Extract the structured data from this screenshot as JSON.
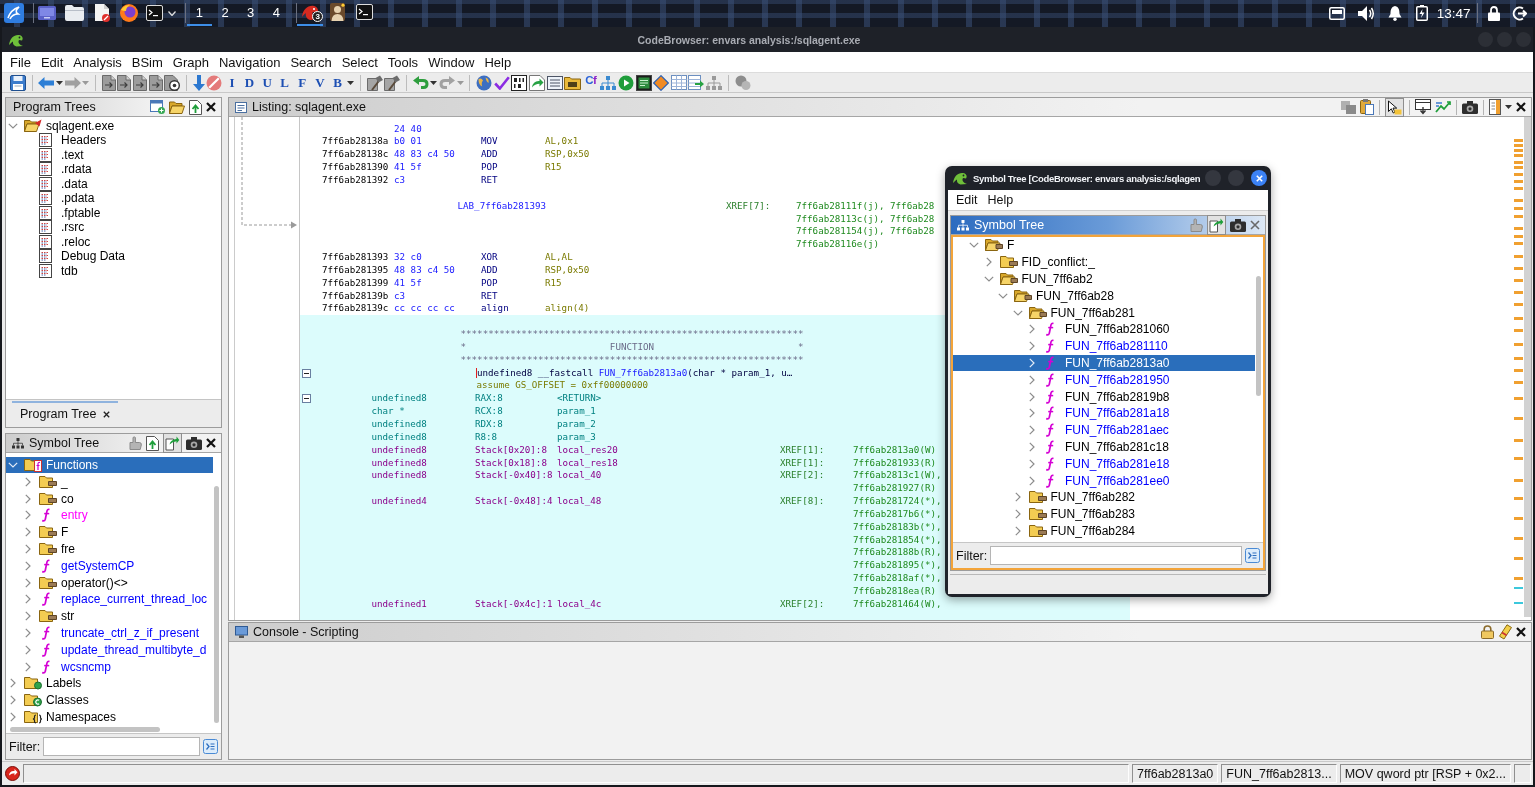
{
  "taskbar": {
    "workspaces": [
      {
        "label": "1",
        "selected": true
      },
      {
        "label": "2",
        "selected": false
      },
      {
        "label": "3",
        "selected": false
      },
      {
        "label": "4",
        "selected": false
      }
    ],
    "apps": [
      {
        "selected": true,
        "badge": "3"
      },
      {
        "selected": false
      },
      {
        "selected": false
      }
    ],
    "clock": "13:47"
  },
  "window": {
    "title": "CodeBrowser: envars analysis:/sqlagent.exe"
  },
  "menu": [
    "File",
    "Edit",
    "Analysis",
    "BSim",
    "Graph",
    "Navigation",
    "Search",
    "Select",
    "Tools",
    "Window",
    "Help"
  ],
  "toolbar": {
    "letter_buttons": [
      "I",
      "D",
      "U",
      "L",
      "F",
      "V",
      "B"
    ],
    "glyph_button": "Cf"
  },
  "program_trees": {
    "title": "Program Trees",
    "tree": [
      {
        "label": "sqlagent.exe",
        "kind": "program",
        "expanded": true,
        "selected": false,
        "children": [
          {
            "label": "Headers",
            "kind": "fragment",
            "selected": false
          },
          {
            "label": ".text",
            "kind": "fragment",
            "selected": false
          },
          {
            "label": ".rdata",
            "kind": "fragment",
            "selected": false
          },
          {
            "label": ".data",
            "kind": "fragment",
            "selected": false
          },
          {
            "label": ".pdata",
            "kind": "fragment",
            "selected": false
          },
          {
            "label": ".fptable",
            "kind": "fragment",
            "selected": false
          },
          {
            "label": ".rsrc",
            "kind": "fragment",
            "selected": false
          },
          {
            "label": ".reloc",
            "kind": "fragment",
            "selected": false
          },
          {
            "label": "Debug Data",
            "kind": "fragment",
            "selected": false
          },
          {
            "label": "tdb",
            "kind": "fragment",
            "selected": false
          }
        ]
      }
    ],
    "tabs": [
      {
        "label": "Program Tree",
        "selected": true
      }
    ]
  },
  "symbol_tree": {
    "title": "Symbol Tree",
    "toggle_buttons": [
      {
        "on": true
      }
    ],
    "tree": [
      {
        "label": "Functions",
        "kind": "functions",
        "expanded": true,
        "selected": true,
        "children": [
          {
            "label": "_",
            "kind": "folder",
            "expanded": false,
            "selected": false
          },
          {
            "label": "co",
            "kind": "folder",
            "expanded": false,
            "selected": false
          },
          {
            "label": "entry",
            "kind": "function",
            "expanded": false,
            "selected": false,
            "color": "#ff00ff"
          },
          {
            "label": "F",
            "kind": "folder",
            "expanded": false,
            "selected": false
          },
          {
            "label": "fre",
            "kind": "folder",
            "expanded": false,
            "selected": false
          },
          {
            "label": "getSystemCP",
            "kind": "function",
            "expanded": false,
            "selected": false,
            "color": "#0000ff"
          },
          {
            "label": "operator()<>",
            "kind": "folder",
            "expanded": false,
            "selected": false
          },
          {
            "label": "replace_current_thread_loc",
            "kind": "function",
            "expanded": false,
            "selected": false,
            "color": "#0000ff"
          },
          {
            "label": "str",
            "kind": "folder",
            "expanded": false,
            "selected": false
          },
          {
            "label": "truncate_ctrl_z_if_present",
            "kind": "function",
            "expanded": false,
            "selected": false,
            "color": "#0000ff"
          },
          {
            "label": "update_thread_multibyte_d",
            "kind": "function",
            "expanded": false,
            "selected": false,
            "color": "#0000ff"
          },
          {
            "label": "wcsncmp",
            "kind": "function",
            "expanded": false,
            "selected": false,
            "color": "#0000ff"
          }
        ]
      },
      {
        "label": "Labels",
        "kind": "labels",
        "expanded": false,
        "selected": false
      },
      {
        "label": "Classes",
        "kind": "classes",
        "expanded": false,
        "selected": false
      },
      {
        "label": "Namespaces",
        "kind": "namespaces",
        "expanded": false,
        "selected": false
      }
    ],
    "filter_label": "Filter:"
  },
  "listing": {
    "title": "Listing: sqlagent.exe",
    "toggle_buttons": [
      {
        "on": true
      }
    ],
    "blocks": [
      {
        "highlighted": false,
        "lines": [
          {
            "kind": "bytes",
            "bytes": "24 40"
          },
          {
            "kind": "code",
            "address": "7ff6ab28138a",
            "bytes": "b0 01",
            "mnemonic": "MOV",
            "operands": "AL,0x1"
          },
          {
            "kind": "code",
            "address": "7ff6ab28138c",
            "bytes": "48 83 c4 50",
            "mnemonic": "ADD",
            "operands": "RSP,0x50"
          },
          {
            "kind": "code",
            "address": "7ff6ab281390",
            "bytes": "41 5f",
            "mnemonic": "POP",
            "operands": "R15"
          },
          {
            "kind": "code",
            "address": "7ff6ab281392",
            "bytes": "c3",
            "mnemonic": "RET"
          },
          {
            "kind": "blank"
          },
          {
            "kind": "label",
            "name": "LAB_7ff6ab281393",
            "xref_label": "XREF[7]:",
            "xref": "7ff6ab28111f(j), 7ff6ab28"
          },
          {
            "kind": "label_xref",
            "xref": "7ff6ab28113c(j), 7ff6ab28"
          },
          {
            "kind": "label_xref",
            "xref": "7ff6ab281154(j), 7ff6ab28"
          },
          {
            "kind": "label_xref",
            "xref": "7ff6ab28116e(j)"
          },
          {
            "kind": "code",
            "address": "7ff6ab281393",
            "bytes": "32 c0",
            "mnemonic": "XOR",
            "operands": "AL,AL"
          },
          {
            "kind": "code",
            "address": "7ff6ab281395",
            "bytes": "48 83 c4 50",
            "mnemonic": "ADD",
            "operands": "RSP,0x50"
          },
          {
            "kind": "code",
            "address": "7ff6ab281399",
            "bytes": "41 5f",
            "mnemonic": "POP",
            "operands": "R15"
          },
          {
            "kind": "code",
            "address": "7ff6ab28139b",
            "bytes": "c3",
            "mnemonic": "RET"
          },
          {
            "kind": "code",
            "address": "7ff6ab28139c",
            "bytes": "cc cc cc cc",
            "mnemonic": "align",
            "operands": "align(4)"
          }
        ]
      },
      {
        "highlighted": true,
        "lines": [
          {
            "kind": "blank"
          },
          {
            "kind": "banner",
            "text": "**************************************************************"
          },
          {
            "kind": "banner",
            "text": "*                          FUNCTION                          *"
          },
          {
            "kind": "banner",
            "text": "**************************************************************"
          },
          {
            "kind": "signature",
            "expanded": true,
            "prefix": "undefined8 __fastcall ",
            "name": "FUN_7ff6ab2813a0",
            "suffix": "(char * param_1, u…"
          },
          {
            "kind": "assume",
            "text": "assume GS_OFFSET = 0xff00000000"
          },
          {
            "kind": "register_variable",
            "expanded": true,
            "datatype": "undefined8",
            "storage": "RAX:8",
            "name": "<RETURN>"
          },
          {
            "kind": "register_variable",
            "datatype": "char *",
            "storage": "RCX:8",
            "name": "param_1"
          },
          {
            "kind": "register_variable",
            "datatype": "undefined8",
            "storage": "RDX:8",
            "name": "param_2"
          },
          {
            "kind": "register_variable",
            "datatype": "undefined8",
            "storage": "R8:8",
            "name": "param_3"
          },
          {
            "kind": "stack_variable",
            "datatype": "undefined8",
            "storage": "Stack[0x20]:8",
            "name": "local_res20",
            "xref_label": "XREF[1]:",
            "xref": "7ff6ab2813a0(W)"
          },
          {
            "kind": "stack_variable",
            "datatype": "undefined8",
            "storage": "Stack[0x18]:8",
            "name": "local_res18",
            "xref_label": "XREF[1]:",
            "xref": "7ff6ab281933(R)"
          },
          {
            "kind": "stack_variable",
            "datatype": "undefined8",
            "storage": "Stack[-0x40]:8",
            "name": "local_40",
            "xref_label": "XREF[2]:",
            "xref": "7ff6ab2813c1(W),"
          },
          {
            "kind": "var_xref",
            "xref": "7ff6ab281927(R)"
          },
          {
            "kind": "stack_variable",
            "datatype": "undefined4",
            "storage": "Stack[-0x48]:4",
            "name": "local_48",
            "xref_label": "XREF[8]:",
            "xref": "7ff6ab281724(*),"
          },
          {
            "kind": "var_xref",
            "xref": "7ff6ab2817b6(*),"
          },
          {
            "kind": "var_xref",
            "xref": "7ff6ab28183b(*),"
          },
          {
            "kind": "var_xref",
            "xref": "7ff6ab281854(*),"
          },
          {
            "kind": "var_xref",
            "xref": "7ff6ab28188b(R),"
          },
          {
            "kind": "var_xref",
            "xref": "7ff6ab281895(*),"
          },
          {
            "kind": "var_xref",
            "xref": "7ff6ab2818af(*),"
          },
          {
            "kind": "var_xref",
            "xref": "7ff6ab2818ea(R)"
          },
          {
            "kind": "stack_variable",
            "datatype": "undefined1",
            "storage": "Stack[-0x4c]:1",
            "name": "local_4c",
            "xref_label": "XREF[2]:",
            "xref": "7ff6ab281464(W),"
          }
        ]
      }
    ]
  },
  "console": {
    "title": "Console - Scripting"
  },
  "status_bar": {
    "fields": [
      "7ff6ab2813a0",
      "FUN_7ff6ab2813...",
      "MOV qword ptr [RSP + 0x2..."
    ]
  },
  "floating_window": {
    "title": "Symbol Tree [CodeBrowser: envars analysis:/sqlagen",
    "menu": [
      "Edit",
      "Help"
    ],
    "panel_title": "Symbol Tree",
    "toggle_buttons": [
      {
        "on": true
      }
    ],
    "tree": [
      {
        "label": "F",
        "kind": "folder",
        "expanded": true,
        "selected": false,
        "children": [
          {
            "label": "FID_conflict:_",
            "kind": "folder",
            "expanded": false,
            "selected": false
          },
          {
            "label": "FUN_7ff6ab2",
            "kind": "folder",
            "expanded": true,
            "selected": false,
            "children": [
              {
                "label": "FUN_7ff6ab28",
                "kind": "folder",
                "expanded": true,
                "selected": false,
                "children": [
                  {
                    "label": "FUN_7ff6ab281",
                    "kind": "folder",
                    "expanded": true,
                    "selected": false,
                    "children": [
                      {
                        "label": "FUN_7ff6ab281060",
                        "kind": "function",
                        "expanded": false,
                        "selected": false,
                        "color": "#000000"
                      },
                      {
                        "label": "FUN_7ff6ab281110",
                        "kind": "function",
                        "expanded": false,
                        "selected": false,
                        "color": "#0000ff"
                      },
                      {
                        "label": "FUN_7ff6ab2813a0",
                        "kind": "function",
                        "expanded": false,
                        "selected": true
                      },
                      {
                        "label": "FUN_7ff6ab281950",
                        "kind": "function",
                        "expanded": false,
                        "selected": false,
                        "color": "#0000ff"
                      },
                      {
                        "label": "FUN_7ff6ab2819b8",
                        "kind": "function",
                        "expanded": false,
                        "selected": false,
                        "color": "#000000"
                      },
                      {
                        "label": "FUN_7ff6ab281a18",
                        "kind": "function",
                        "expanded": false,
                        "selected": false,
                        "color": "#0000ff"
                      },
                      {
                        "label": "FUN_7ff6ab281aec",
                        "kind": "function",
                        "expanded": false,
                        "selected": false,
                        "color": "#0000ff"
                      },
                      {
                        "label": "FUN_7ff6ab281c18",
                        "kind": "function",
                        "expanded": false,
                        "selected": false,
                        "color": "#000000"
                      },
                      {
                        "label": "FUN_7ff6ab281e18",
                        "kind": "function",
                        "expanded": false,
                        "selected": false,
                        "color": "#0000ff"
                      },
                      {
                        "label": "FUN_7ff6ab281ee0",
                        "kind": "function",
                        "expanded": false,
                        "selected": false,
                        "color": "#0000ff"
                      }
                    ]
                  },
                  {
                    "label": "FUN_7ff6ab282",
                    "kind": "folder",
                    "expanded": false,
                    "selected": false
                  },
                  {
                    "label": "FUN_7ff6ab283",
                    "kind": "folder",
                    "expanded": false,
                    "selected": false
                  },
                  {
                    "label": "FUN_7ff6ab284",
                    "kind": "folder",
                    "expanded": false,
                    "selected": false
                  }
                ]
              }
            ]
          }
        ]
      }
    ],
    "filter_label": "Filter:"
  }
}
